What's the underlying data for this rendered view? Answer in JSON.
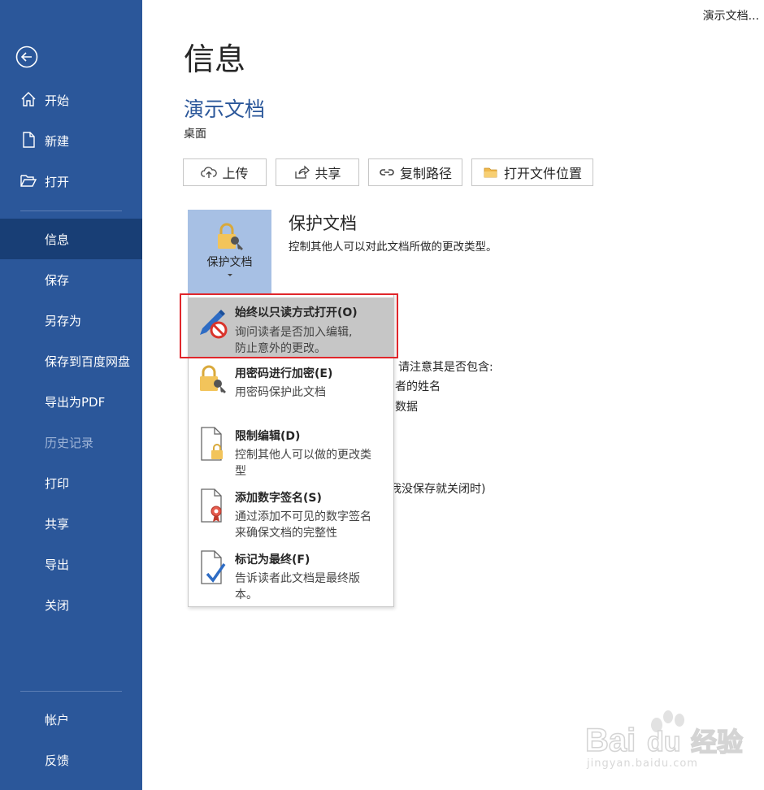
{
  "window": {
    "title": "演示文档..."
  },
  "sidebar": {
    "items": [
      {
        "label": "开始",
        "icon": "home-icon"
      },
      {
        "label": "新建",
        "icon": "new-document-icon"
      },
      {
        "label": "打开",
        "icon": "open-folder-icon"
      },
      {
        "label": "信息",
        "active": true
      },
      {
        "label": "保存"
      },
      {
        "label": "另存为"
      },
      {
        "label": "保存到百度网盘"
      },
      {
        "label": "导出为PDF"
      },
      {
        "label": "历史记录",
        "disabled": true
      },
      {
        "label": "打印"
      },
      {
        "label": "共享"
      },
      {
        "label": "导出"
      },
      {
        "label": "关闭"
      },
      {
        "label": "帐户"
      },
      {
        "label": "反馈"
      }
    ],
    "colors": {
      "background": "#2b579a",
      "active": "#183e75"
    }
  },
  "main": {
    "title": "信息",
    "doc_name": "演示文档",
    "doc_location": "桌面",
    "buttons": [
      {
        "label": "上传",
        "icon": "upload-icon"
      },
      {
        "label": "共享",
        "icon": "share-icon"
      },
      {
        "label": "复制路径",
        "icon": "link-icon"
      },
      {
        "label": "打开文件位置",
        "icon": "folder-icon"
      }
    ],
    "protect": {
      "tile_label": "保护文档",
      "title": "保护文档",
      "description": "控制其他人可以对此文档所做的更改类型。"
    },
    "background_fragments": [
      "请注意其是否包含:",
      "者的姓名",
      "数据",
      "我没保存就关闭时)"
    ]
  },
  "menu": {
    "items": [
      {
        "title": "始终以只读方式打开(O)",
        "desc": "询问读者是否加入编辑,\n防止意外的更改。",
        "icon": "pencil-no-icon",
        "highlight": true
      },
      {
        "title": "用密码进行加密(E)",
        "desc": "用密码保护此文档",
        "icon": "lock-key-icon"
      },
      {
        "title": "限制编辑(D)",
        "desc": "控制其他人可以做的更改类型",
        "icon": "document-lock-icon"
      },
      {
        "title": "添加数字签名(S)",
        "desc": "通过添加不可见的数字签名来确保文档的完整性",
        "icon": "document-ribbon-icon"
      },
      {
        "title": "标记为最终(F)",
        "desc": "告诉读者此文档是最终版本。",
        "icon": "document-check-icon"
      }
    ]
  },
  "watermark": {
    "logo_text": "Baidu经验",
    "url": "jingyan.baidu.com"
  }
}
